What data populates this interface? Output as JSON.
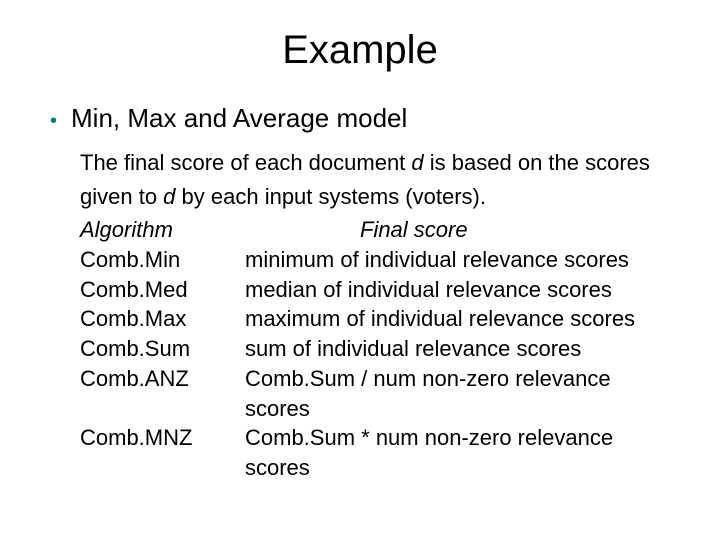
{
  "title": "Example",
  "bullet": "Min, Max and Average model",
  "intro_1a": "The final score of each document ",
  "intro_1b": "d",
  "intro_1c": " is based on the scores",
  "intro_2a": "given to ",
  "intro_2b": "d",
  "intro_2c": " by each input systems (voters).",
  "header_left": "Algorithm",
  "header_right": "Final score",
  "rows": [
    {
      "algo": "Comb.Min",
      "score": "minimum of individual relevance scores"
    },
    {
      "algo": "Comb.Med",
      "score": "median of individual relevance scores"
    },
    {
      "algo": "Comb.Max",
      "score": "maximum of individual relevance scores"
    },
    {
      "algo": "Comb.Sum",
      "score": "sum of individual relevance scores"
    },
    {
      "algo": "Comb.ANZ",
      "score": "Comb.Sum / num non-zero relevance scores"
    },
    {
      "algo": "Comb.MNZ",
      "score": "Comb.Sum * num non-zero relevance scores"
    }
  ]
}
